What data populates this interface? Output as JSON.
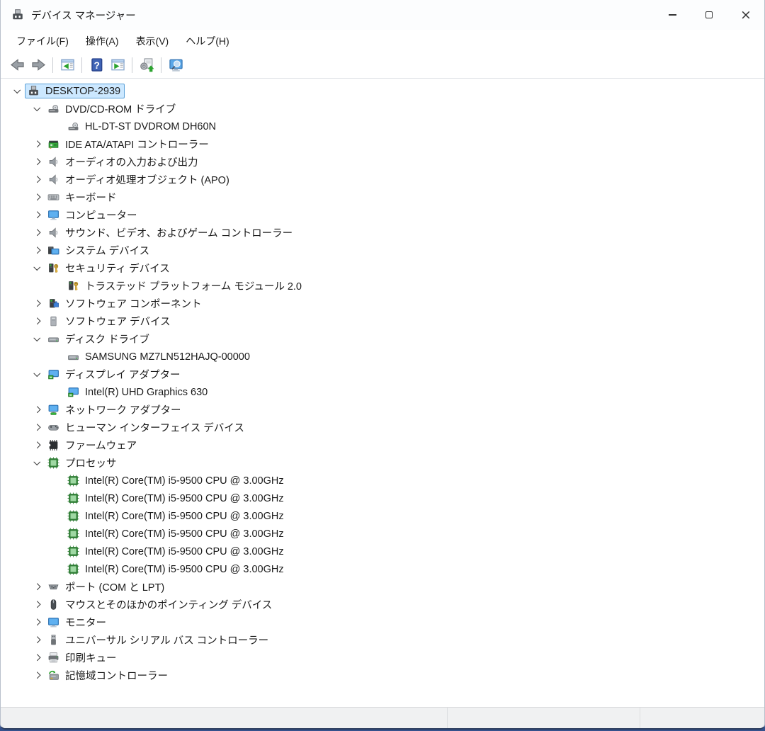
{
  "window": {
    "title": "デバイス マネージャー",
    "controls": {
      "minimize": "minimize",
      "maximize": "maximize",
      "close": "close"
    }
  },
  "menu": {
    "items": [
      {
        "label": "ファイル(F)"
      },
      {
        "label": "操作(A)"
      },
      {
        "label": "表示(V)"
      },
      {
        "label": "ヘルプ(H)"
      }
    ]
  },
  "toolbar": {
    "buttons": [
      {
        "name": "back-button",
        "icon": "back-arrow-icon"
      },
      {
        "name": "forward-button",
        "icon": "forward-arrow-icon"
      },
      {
        "name": "show-hide-console-tree-button",
        "icon": "console-tree-icon"
      },
      {
        "name": "help-button",
        "icon": "help-icon"
      },
      {
        "name": "properties-button",
        "icon": "properties-icon"
      },
      {
        "name": "scan-hardware-changes-button",
        "icon": "scan-hardware-icon"
      },
      {
        "name": "device-search-button",
        "icon": "monitor-search-icon"
      }
    ]
  },
  "tree": {
    "items": [
      {
        "level": 0,
        "state": "expanded",
        "selected": true,
        "icon": "computer-icon",
        "label": "DESKTOP-2939"
      },
      {
        "level": 1,
        "state": "expanded",
        "selected": false,
        "icon": "dvd-drive-icon",
        "label": "DVD/CD-ROM ドライブ"
      },
      {
        "level": 2,
        "state": "leaf",
        "selected": false,
        "icon": "dvd-drive-icon",
        "label": "HL-DT-ST DVDROM DH60N"
      },
      {
        "level": 1,
        "state": "collapsed",
        "selected": false,
        "icon": "ide-controller-icon",
        "label": "IDE ATA/ATAPI コントローラー"
      },
      {
        "level": 1,
        "state": "collapsed",
        "selected": false,
        "icon": "speaker-icon",
        "label": "オーディオの入力および出力"
      },
      {
        "level": 1,
        "state": "collapsed",
        "selected": false,
        "icon": "speaker-icon",
        "label": "オーディオ処理オブジェクト (APO)"
      },
      {
        "level": 1,
        "state": "collapsed",
        "selected": false,
        "icon": "keyboard-icon",
        "label": "キーボード"
      },
      {
        "level": 1,
        "state": "collapsed",
        "selected": false,
        "icon": "monitor-icon",
        "label": "コンピューター"
      },
      {
        "level": 1,
        "state": "collapsed",
        "selected": false,
        "icon": "speaker-icon",
        "label": "サウンド、ビデオ、およびゲーム コントローラー"
      },
      {
        "level": 1,
        "state": "collapsed",
        "selected": false,
        "icon": "system-device-icon",
        "label": "システム デバイス"
      },
      {
        "level": 1,
        "state": "expanded",
        "selected": false,
        "icon": "security-device-icon",
        "label": "セキュリティ デバイス"
      },
      {
        "level": 2,
        "state": "leaf",
        "selected": false,
        "icon": "security-device-icon",
        "label": "トラステッド プラットフォーム モジュール 2.0"
      },
      {
        "level": 1,
        "state": "collapsed",
        "selected": false,
        "icon": "software-component-icon",
        "label": "ソフトウェア コンポーネント"
      },
      {
        "level": 1,
        "state": "collapsed",
        "selected": false,
        "icon": "software-device-icon",
        "label": "ソフトウェア デバイス"
      },
      {
        "level": 1,
        "state": "expanded",
        "selected": false,
        "icon": "disk-drive-icon",
        "label": "ディスク ドライブ"
      },
      {
        "level": 2,
        "state": "leaf",
        "selected": false,
        "icon": "disk-drive-icon",
        "label": "SAMSUNG MZ7LN512HAJQ-00000"
      },
      {
        "level": 1,
        "state": "expanded",
        "selected": false,
        "icon": "display-adapter-icon",
        "label": "ディスプレイ アダプター"
      },
      {
        "level": 2,
        "state": "leaf",
        "selected": false,
        "icon": "display-adapter-icon",
        "label": "Intel(R) UHD Graphics 630"
      },
      {
        "level": 1,
        "state": "collapsed",
        "selected": false,
        "icon": "network-adapter-icon",
        "label": "ネットワーク アダプター"
      },
      {
        "level": 1,
        "state": "collapsed",
        "selected": false,
        "icon": "hid-icon",
        "label": "ヒューマン インターフェイス デバイス"
      },
      {
        "level": 1,
        "state": "collapsed",
        "selected": false,
        "icon": "firmware-icon",
        "label": "ファームウェア"
      },
      {
        "level": 1,
        "state": "expanded",
        "selected": false,
        "icon": "processor-icon",
        "label": "プロセッサ"
      },
      {
        "level": 2,
        "state": "leaf",
        "selected": false,
        "icon": "processor-icon",
        "label": "Intel(R) Core(TM) i5-9500 CPU @ 3.00GHz"
      },
      {
        "level": 2,
        "state": "leaf",
        "selected": false,
        "icon": "processor-icon",
        "label": "Intel(R) Core(TM) i5-9500 CPU @ 3.00GHz"
      },
      {
        "level": 2,
        "state": "leaf",
        "selected": false,
        "icon": "processor-icon",
        "label": "Intel(R) Core(TM) i5-9500 CPU @ 3.00GHz"
      },
      {
        "level": 2,
        "state": "leaf",
        "selected": false,
        "icon": "processor-icon",
        "label": "Intel(R) Core(TM) i5-9500 CPU @ 3.00GHz"
      },
      {
        "level": 2,
        "state": "leaf",
        "selected": false,
        "icon": "processor-icon",
        "label": "Intel(R) Core(TM) i5-9500 CPU @ 3.00GHz"
      },
      {
        "level": 2,
        "state": "leaf",
        "selected": false,
        "icon": "processor-icon",
        "label": "Intel(R) Core(TM) i5-9500 CPU @ 3.00GHz"
      },
      {
        "level": 1,
        "state": "collapsed",
        "selected": false,
        "icon": "port-icon",
        "label": "ポート (COM と LPT)"
      },
      {
        "level": 1,
        "state": "collapsed",
        "selected": false,
        "icon": "mouse-icon",
        "label": "マウスとそのほかのポインティング デバイス"
      },
      {
        "level": 1,
        "state": "collapsed",
        "selected": false,
        "icon": "monitor-icon",
        "label": "モニター"
      },
      {
        "level": 1,
        "state": "collapsed",
        "selected": false,
        "icon": "usb-icon",
        "label": "ユニバーサル シリアル バス コントローラー"
      },
      {
        "level": 1,
        "state": "collapsed",
        "selected": false,
        "icon": "printer-icon",
        "label": "印刷キュー"
      },
      {
        "level": 1,
        "state": "collapsed",
        "selected": false,
        "icon": "storage-controller-icon",
        "label": "記憶域コントローラー"
      }
    ]
  },
  "statusbar": {
    "sections": [
      "",
      "",
      ""
    ]
  },
  "colors": {
    "selection_bg": "#cce8ff",
    "selection_border": "#5ba0d7",
    "help_blue": "#3f63b5",
    "accent_green": "#2ca32f",
    "window_edge": "#2c3d5e"
  }
}
